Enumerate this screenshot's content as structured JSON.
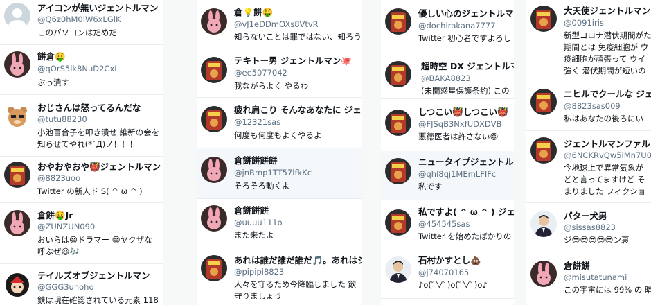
{
  "columns": [
    {
      "posts": [
        {
          "name": "アイコンが無いジェントルマン",
          "handle": "@Q6z0hM0lW6xLGlK",
          "text": "このパソコンはだめだ",
          "avatar": "default-avatar-icon"
        },
        {
          "name": "餅倉🤑",
          "handle": "@qOrS5lk8NuD2CxI",
          "text": "ぶっ潰す",
          "avatar": "bunny-avatar-icon"
        },
        {
          "name": "おじさんは怒ってるんだな",
          "handle": "@tutu88230",
          "text": "小池百合子を叩き潰せ 維新の会を\n知らせてやれ(*`Д)ノ！！！",
          "avatar": "bear-avatar-icon"
        },
        {
          "name": "おやおやおや👹ジェントルマン",
          "handle": "@8823uoo",
          "text": "Twitter の新人ド S( ^ ω ^ )",
          "avatar": "food-avatar-icon"
        },
        {
          "name": "倉餅🤑Jr",
          "handle": "@ZUNZUN090",
          "text": "おいらは😃ドラマー 😃ヤクザな\n呼ぶぜ😃🎶",
          "avatar": "bunny-avatar-icon"
        },
        {
          "name": "テイルズオブジェントルマン",
          "handle": "@GGG3uhoho",
          "text": "鉄は現在確認されている元素 118",
          "avatar": "anime-avatar-icon"
        }
      ]
    },
    {
      "posts": [
        {
          "name": "倉💡餅🤑",
          "handle": "@vJ1eDDmOXs8VtvR",
          "text": "知らないことは罪ではない、知ろう",
          "avatar": "bunny-avatar-icon"
        },
        {
          "name": "テキトー男 ジェントルマン🐙",
          "handle": "@ee5077042",
          "text": "我ながらよく やるわ",
          "avatar": "food-avatar-icon"
        },
        {
          "name": "疲れ肩こり そんなあなたに ジェン",
          "handle": "@12321sas",
          "text": "何度も何度もよくやるよ",
          "avatar": "food-avatar-icon"
        },
        {
          "name": "倉餅餅餅餅",
          "handle": "@jnRmp1TT57lfkKc",
          "text": "そろそろ動くよ",
          "avatar": "bunny-avatar-icon"
        },
        {
          "name": "倉餅餅餅",
          "handle": "@uuuu111o",
          "text": "また来たよ",
          "avatar": "bunny-avatar-icon"
        },
        {
          "name": "あれは誰だ誰だ誰だ🎵。あれはジ",
          "handle": "@pipipi8823",
          "text": "人々を守るため今降臨しました 飲\n守りましょう",
          "avatar": "food-avatar-icon"
        }
      ]
    },
    {
      "posts": [
        {
          "name": "優しい心のジェントルマ",
          "handle": "@dochirakana7777",
          "text": "Twitter 初心者ですよろし",
          "avatar": "food-avatar-icon"
        },
        {
          "name": "超時空 DX ジェントルマン",
          "handle": "@BAKA8823",
          "text": "(未開惑星保護条約) この",
          "avatar": "food-avatar-icon"
        },
        {
          "name": "しつこい👹しつこい👹",
          "handle": "@FJSqB3NxfUDXDVB",
          "text": "悪徳医者は許さない😡",
          "avatar": "food-avatar-icon"
        },
        {
          "name": "ニュータイプジェントル",
          "handle": "@qhl8qj1MEmLFIFc",
          "text": "私です",
          "avatar": "food-avatar-icon"
        },
        {
          "name": "私ですよ( ^ ω ^ ) ジェン",
          "handle": "@454545sas",
          "text": "Twitter を始めたばかりの",
          "avatar": "food-avatar-icon"
        },
        {
          "name": "石村かすとし💩",
          "handle": "@j74070165",
          "text": "♪o(ﾟ∀ﾟ)o(ﾟ∀ﾟ)o♪",
          "avatar": "man-avatar-icon"
        }
      ]
    },
    {
      "posts": [
        {
          "name": "大天使ジェントルマン",
          "handle": "@0091iris",
          "text": "新型コロナ潜伏期間がた\n期間とは 免疫細胞が ウ\n疫細胞が頑張って ウイ\n強く 潜伏期間が短いの",
          "avatar": "food-avatar-icon"
        },
        {
          "name": "ニヒルでクールな ジェ",
          "handle": "@8823sas009",
          "text": "私はあなたの後ろにい",
          "avatar": "food-avatar-icon"
        },
        {
          "name": "ジェントルマンファル",
          "handle": "@6NCKRvQw5iMn7U0",
          "text": "今地球上で異常気象が\nどと言ってますけど そ\nまりました フィクショ",
          "avatar": "food-avatar-icon"
        },
        {
          "name": "パター犬男",
          "handle": "@sissas8823",
          "text": "ジ😎😎😎😎😎ン裏",
          "avatar": "man-avatar-icon"
        },
        {
          "name": "倉餅餅",
          "handle": "@misutatunami",
          "text": "この宇宙には 99% の 暗",
          "avatar": "bunny-avatar-icon"
        }
      ]
    }
  ],
  "colors": {
    "name": "#0f1419",
    "handle": "#5b7083",
    "divider": "#e6ecf0",
    "background": "#ffffff"
  }
}
